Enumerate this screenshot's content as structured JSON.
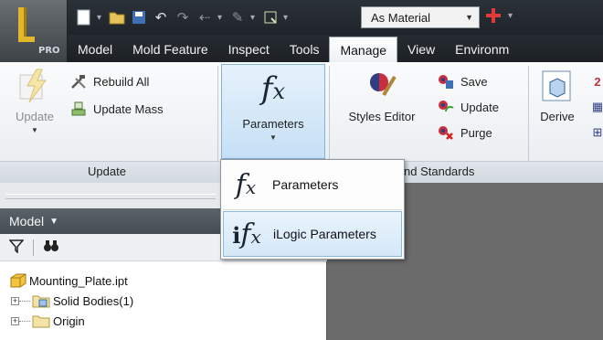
{
  "app": {
    "edition_badge": "PRO"
  },
  "qat": {
    "material_value": "As Material"
  },
  "tabs": [
    {
      "label": "Model",
      "active": false
    },
    {
      "label": "Mold Feature",
      "active": false
    },
    {
      "label": "Inspect",
      "active": false
    },
    {
      "label": "Tools",
      "active": false
    },
    {
      "label": "Manage",
      "active": true
    },
    {
      "label": "View",
      "active": false
    },
    {
      "label": "Environm",
      "active": false
    }
  ],
  "ribbon": {
    "update_panel": {
      "update_label": "Update",
      "rebuild_all_label": "Rebuild All",
      "update_mass_label": "Update Mass",
      "panel_label": "Update"
    },
    "parameters_label": "Parameters",
    "styles_panel": {
      "styles_editor_label": "Styles Editor",
      "save_label": "Save",
      "update_label": "Update",
      "purge_label": "Purge",
      "panel_label_visible": "nd Standards"
    },
    "derive_label": "Derive"
  },
  "parameters_menu": {
    "items": [
      {
        "label": "Parameters",
        "highlighted": false
      },
      {
        "label": "iLogic Parameters",
        "highlighted": true
      }
    ]
  },
  "browser": {
    "title": "Model",
    "tree": [
      {
        "label": "Mounting_Plate.ipt"
      },
      {
        "label": "Solid Bodies(1)"
      },
      {
        "label": "Origin"
      }
    ]
  },
  "colors": {
    "ribbon_highlight": "#c6e0f5",
    "title_bar": "#1f242a",
    "browser_header": "#4f575e"
  }
}
